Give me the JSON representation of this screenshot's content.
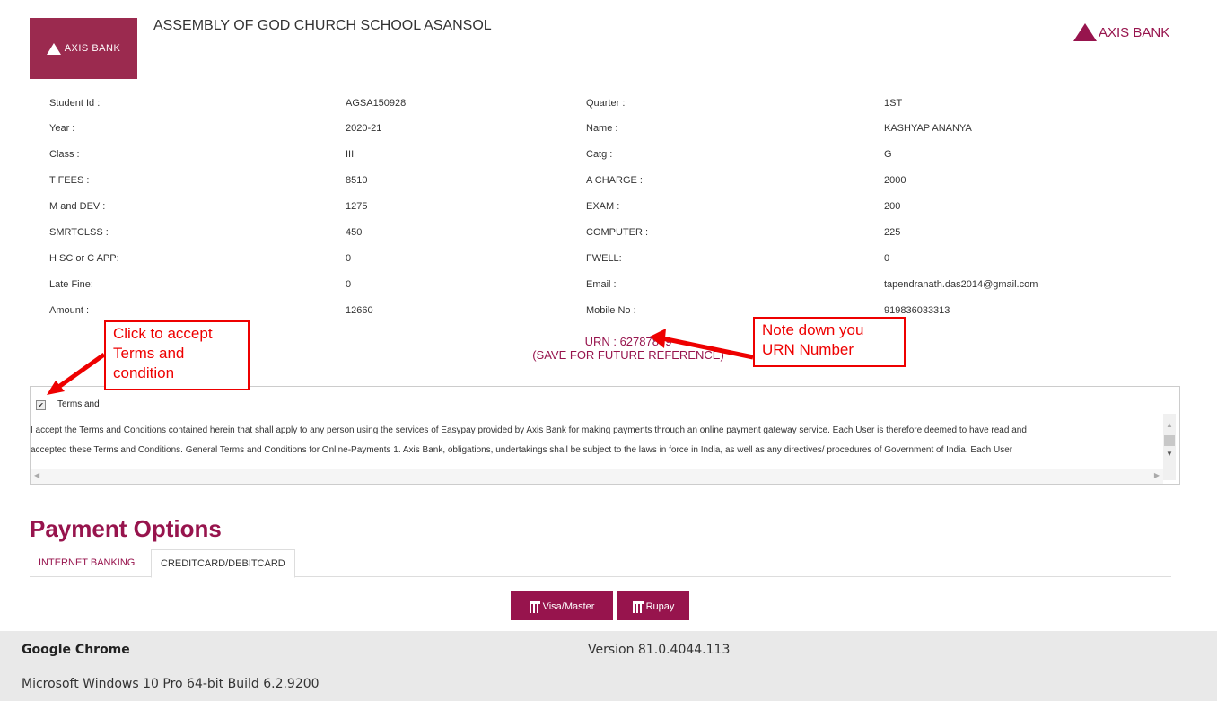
{
  "header": {
    "logo_text": "AXIS BANK",
    "school_name": "ASSEMBLY OF GOD CHURCH SCHOOL ASANSOL",
    "brand_right": "AXIS BANK"
  },
  "details": [
    {
      "l1": "Student Id :",
      "v1": "AGSA150928",
      "l2": "Quarter :",
      "v2": "1ST"
    },
    {
      "l1": "Year :",
      "v1": "2020-21",
      "l2": "Name :",
      "v2": "KASHYAP ANANYA"
    },
    {
      "l1": "Class :",
      "v1": "III",
      "l2": "Catg :",
      "v2": "G"
    },
    {
      "l1": "T FEES :",
      "v1": "8510",
      "l2": "A CHARGE :",
      "v2": "2000"
    },
    {
      "l1": "M and DEV :",
      "v1": "1275",
      "l2": "EXAM :",
      "v2": "200"
    },
    {
      "l1": "SMRTCLSS :",
      "v1": "450",
      "l2": "COMPUTER :",
      "v2": "225"
    },
    {
      "l1": "H SC or C APP:",
      "v1": "0",
      "l2": "FWELL:",
      "v2": "0"
    },
    {
      "l1": "Late Fine:",
      "v1": "0",
      "l2": "Email :",
      "v2": "tapendranath.das2014@gmail.com"
    },
    {
      "l1": "Amount :",
      "v1": "12660",
      "l2": "Mobile No :",
      "v2": "919836033313"
    }
  ],
  "urn": {
    "line1": "URN : 62787869",
    "line2": "(SAVE FOR FUTURE REFERENCE)"
  },
  "terms": {
    "checked": true,
    "title": "Terms and",
    "line1": "I accept the Terms and Conditions contained herein that shall apply to any person using the services of Easypay provided by Axis Bank for making payments through an online payment gateway service. Each User is therefore deemed to have read and",
    "line2": "accepted these Terms and Conditions. General Terms and Conditions for Online-Payments 1. Axis Bank, obligations, undertakings shall be subject to the laws in force in India, as well as any directives/ procedures of Government of India. Each User"
  },
  "payment": {
    "title": "Payment Options",
    "tabs": [
      "INTERNET BANKING",
      "CREDITCARD/DEBITCARD"
    ],
    "buttons": [
      "Visa/Master",
      "Rupay"
    ]
  },
  "footer": {
    "app": "Google Chrome",
    "version": "Version 81.0.4044.113",
    "os": "Microsoft Windows 10 Pro 64-bit Build 6.2.9200"
  },
  "annotations": {
    "accept": [
      "Click to accept",
      "Terms and",
      "condition"
    ],
    "urn_note": [
      "Note down you",
      "URN Number"
    ]
  },
  "colors": {
    "brand": "#97144d",
    "callout": "#e00000",
    "footer_bg": "#e9e9e9"
  }
}
